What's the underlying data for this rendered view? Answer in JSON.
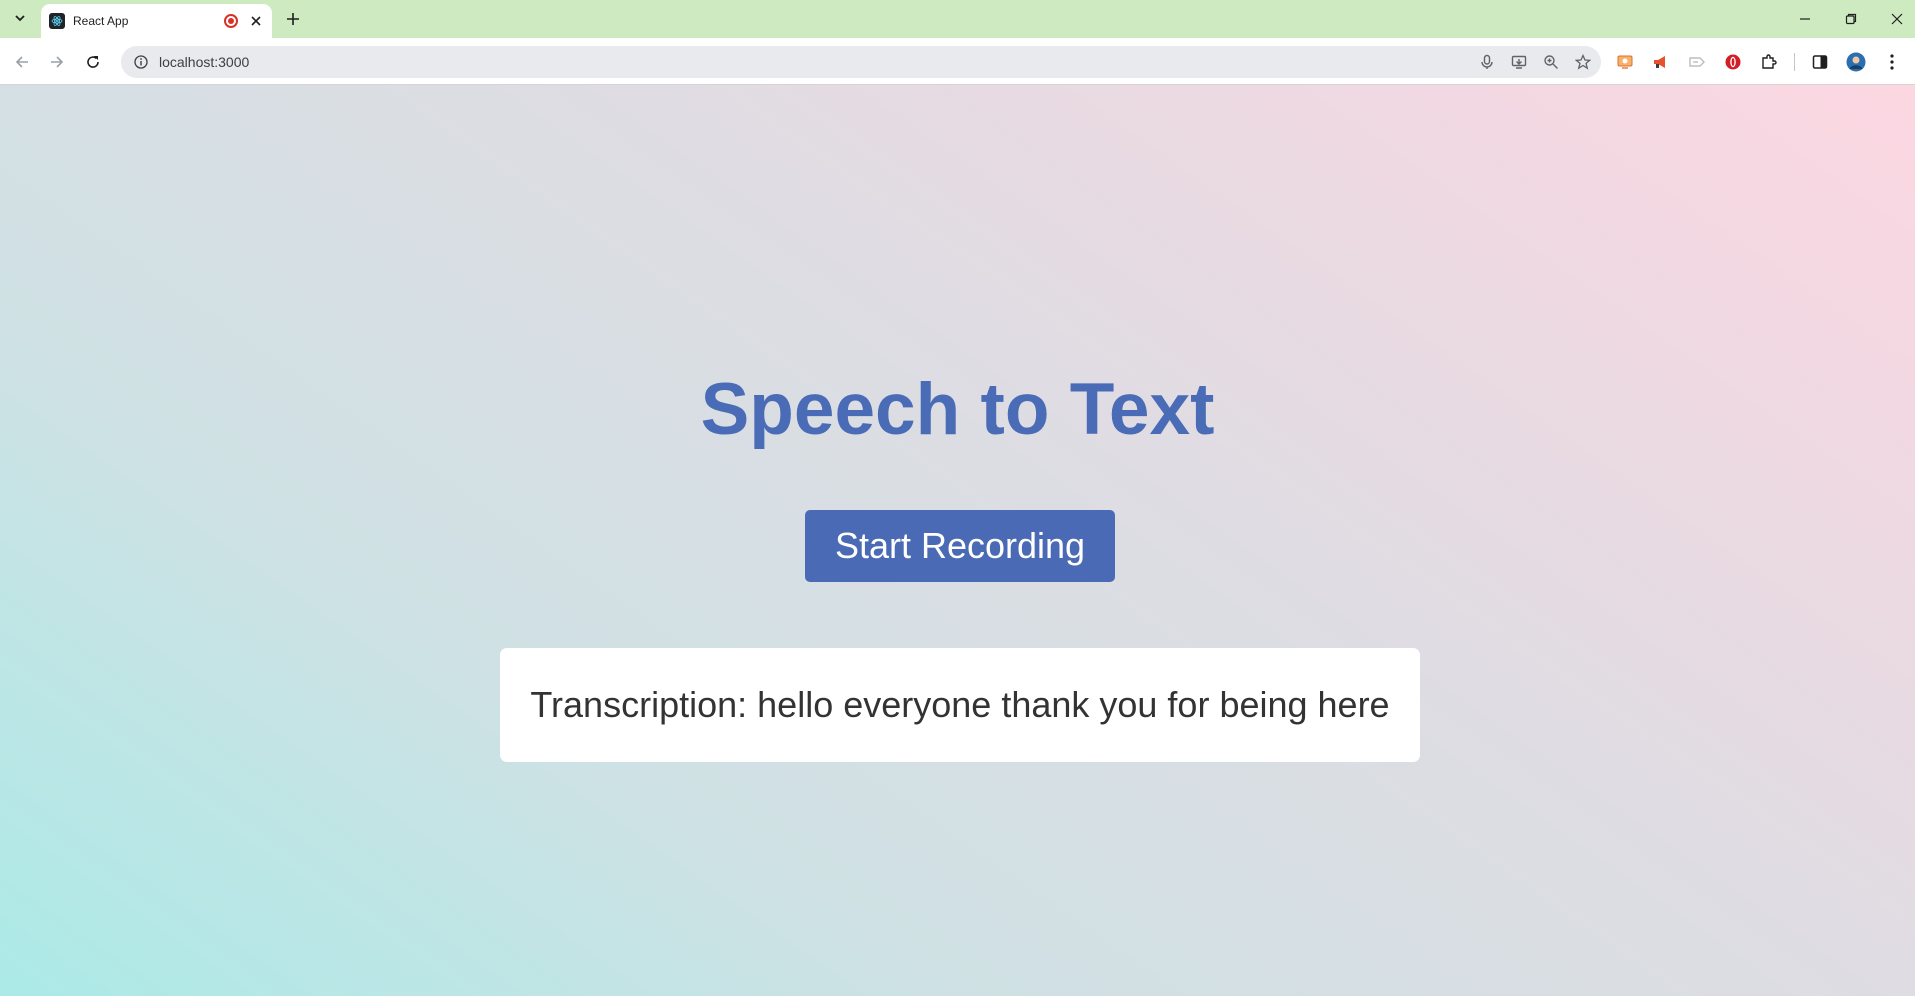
{
  "browser": {
    "tab": {
      "title": "React App"
    },
    "address": {
      "url": "localhost:3000"
    },
    "window_controls": [
      "minimize",
      "restore",
      "close"
    ]
  },
  "page": {
    "heading": "Speech to Text",
    "record_button_label": "Start Recording",
    "transcription_label": "Transcription:",
    "transcription_text": "hello everyone thank you for being here"
  },
  "colors": {
    "tabstrip_bg": "#cdeac0",
    "heading": "#4a6bb6",
    "button_bg": "#4b6ab5",
    "gradient_start": "#abeae7",
    "gradient_end": "#fcd7e2"
  }
}
